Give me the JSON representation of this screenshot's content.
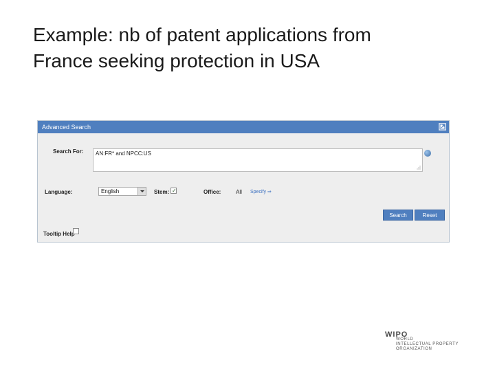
{
  "slide": {
    "title_line1": "Example: nb of patent applications from",
    "title_line2": "France seeking protection in USA"
  },
  "panel": {
    "header_title": "Advanced Search",
    "search_label": "Search For:",
    "search_value": "AN:FR* and NPCC:US",
    "language_label": "Language:",
    "language_value": "English",
    "stem_label": "Stem:",
    "stem_checked": true,
    "office_label": "Office:",
    "office_value": "All",
    "specify_link": "Specify ⇒",
    "search_button": "Search",
    "reset_button": "Reset",
    "tooltip_help_label": "Tooltip Help",
    "tooltip_help_checked": false
  },
  "logo": {
    "name": "WIPO",
    "line1": "WORLD",
    "line2": "INTELLECTUAL PROPERTY",
    "line3": "ORGANIZATION"
  },
  "colors": {
    "header_blue": "#4f7fbf",
    "panel_bg": "#eeeeee",
    "link_blue": "#3a6fc0"
  },
  "icons": {
    "header_action": "expand-window-icon",
    "search_help": "help-icon",
    "language_dropdown": "chevron-down-icon"
  }
}
